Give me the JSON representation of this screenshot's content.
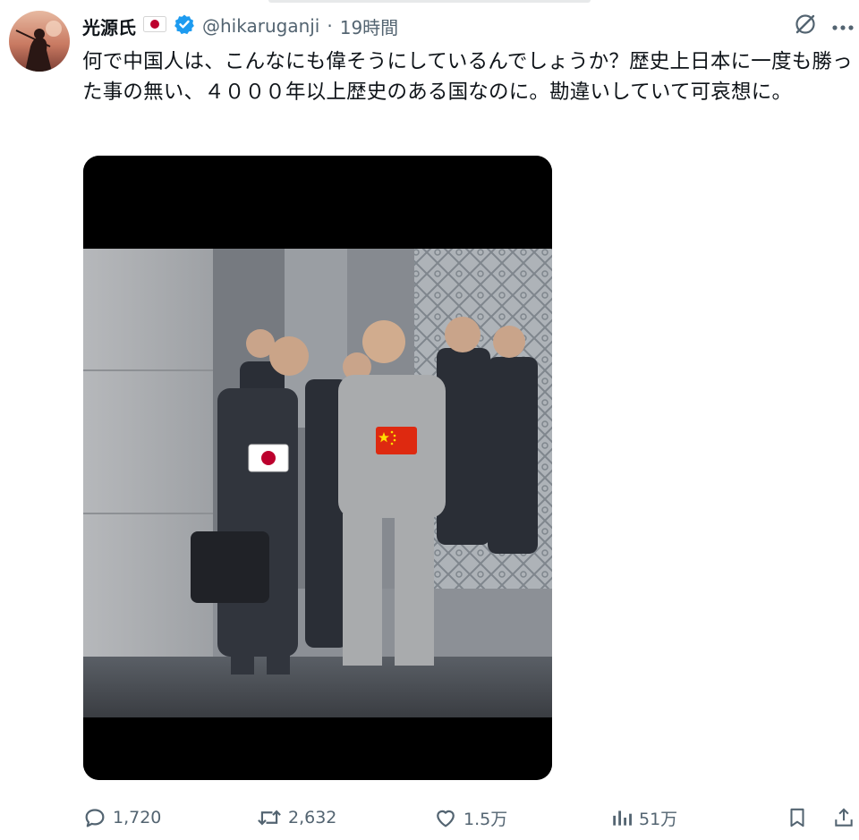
{
  "tweet": {
    "author": {
      "display_name": "光源氏",
      "handle": "@hikaruganji",
      "separator": "·",
      "timestamp": "19時間",
      "badge_icon": "verified-badge-icon",
      "flag_icon": "japan-flag-icon"
    },
    "text": "何で中国人は、こんなにも偉そうにしているんでしょうか？歴史上日本に一度も勝った事の無い、４０００年以上歴史のある国なのに。勘違いしていて可哀想に。",
    "media": {
      "icons": [
        "japan-flag-icon",
        "china-flag-icon"
      ]
    },
    "actions": {
      "replies": "1,720",
      "reposts": "2,632",
      "likes": "1.5万",
      "views": "51万"
    }
  },
  "colors": {
    "text": "#0f1419",
    "secondary": "#536471",
    "verified": "#1d9bf0",
    "japan_red": "#bc002d",
    "china_red": "#de2910",
    "china_yellow": "#ffde00"
  }
}
